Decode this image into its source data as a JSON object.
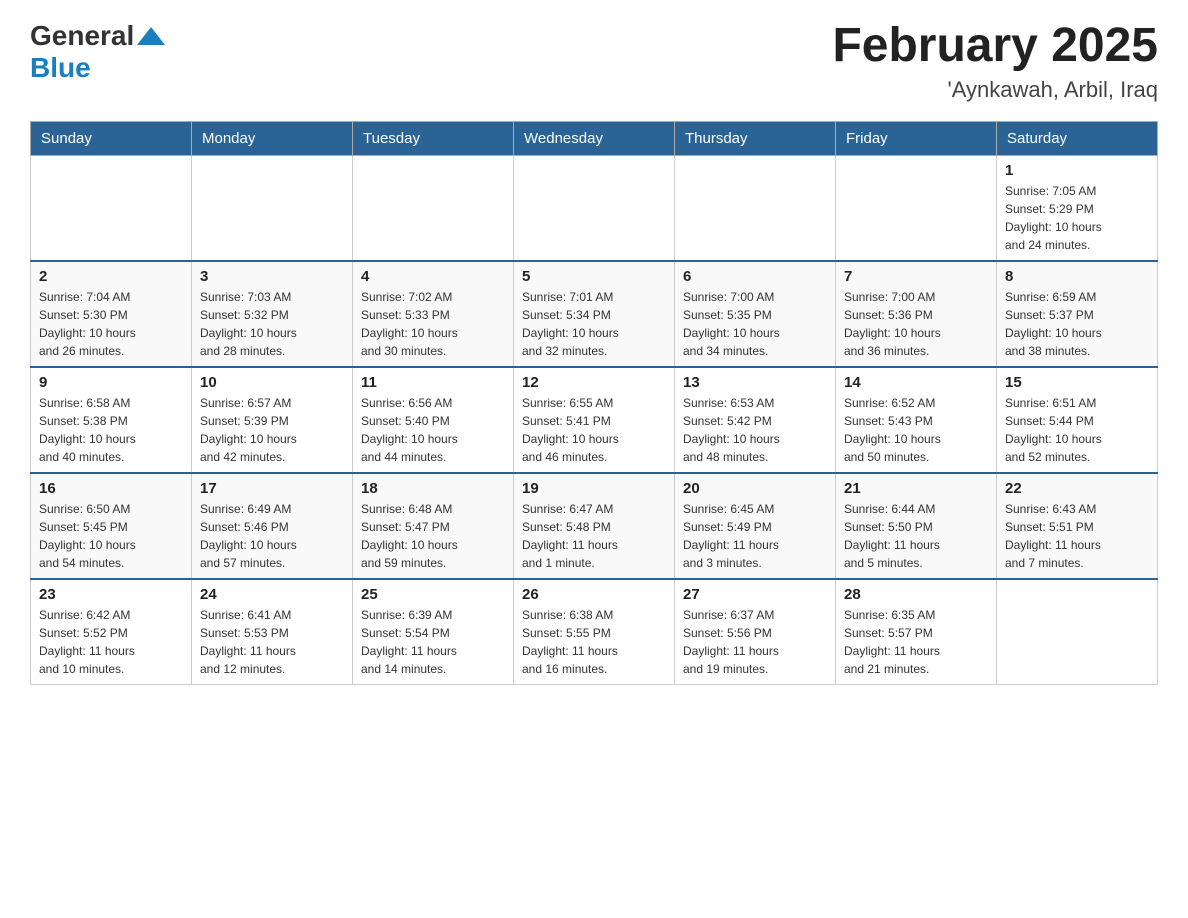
{
  "header": {
    "logo_general": "General",
    "logo_blue": "Blue",
    "title": "February 2025",
    "subtitle": "'Aynkawah, Arbil, Iraq"
  },
  "days_of_week": [
    "Sunday",
    "Monday",
    "Tuesday",
    "Wednesday",
    "Thursday",
    "Friday",
    "Saturday"
  ],
  "weeks": [
    [
      {
        "day": "",
        "info": ""
      },
      {
        "day": "",
        "info": ""
      },
      {
        "day": "",
        "info": ""
      },
      {
        "day": "",
        "info": ""
      },
      {
        "day": "",
        "info": ""
      },
      {
        "day": "",
        "info": ""
      },
      {
        "day": "1",
        "info": "Sunrise: 7:05 AM\nSunset: 5:29 PM\nDaylight: 10 hours\nand 24 minutes."
      }
    ],
    [
      {
        "day": "2",
        "info": "Sunrise: 7:04 AM\nSunset: 5:30 PM\nDaylight: 10 hours\nand 26 minutes."
      },
      {
        "day": "3",
        "info": "Sunrise: 7:03 AM\nSunset: 5:32 PM\nDaylight: 10 hours\nand 28 minutes."
      },
      {
        "day": "4",
        "info": "Sunrise: 7:02 AM\nSunset: 5:33 PM\nDaylight: 10 hours\nand 30 minutes."
      },
      {
        "day": "5",
        "info": "Sunrise: 7:01 AM\nSunset: 5:34 PM\nDaylight: 10 hours\nand 32 minutes."
      },
      {
        "day": "6",
        "info": "Sunrise: 7:00 AM\nSunset: 5:35 PM\nDaylight: 10 hours\nand 34 minutes."
      },
      {
        "day": "7",
        "info": "Sunrise: 7:00 AM\nSunset: 5:36 PM\nDaylight: 10 hours\nand 36 minutes."
      },
      {
        "day": "8",
        "info": "Sunrise: 6:59 AM\nSunset: 5:37 PM\nDaylight: 10 hours\nand 38 minutes."
      }
    ],
    [
      {
        "day": "9",
        "info": "Sunrise: 6:58 AM\nSunset: 5:38 PM\nDaylight: 10 hours\nand 40 minutes."
      },
      {
        "day": "10",
        "info": "Sunrise: 6:57 AM\nSunset: 5:39 PM\nDaylight: 10 hours\nand 42 minutes."
      },
      {
        "day": "11",
        "info": "Sunrise: 6:56 AM\nSunset: 5:40 PM\nDaylight: 10 hours\nand 44 minutes."
      },
      {
        "day": "12",
        "info": "Sunrise: 6:55 AM\nSunset: 5:41 PM\nDaylight: 10 hours\nand 46 minutes."
      },
      {
        "day": "13",
        "info": "Sunrise: 6:53 AM\nSunset: 5:42 PM\nDaylight: 10 hours\nand 48 minutes."
      },
      {
        "day": "14",
        "info": "Sunrise: 6:52 AM\nSunset: 5:43 PM\nDaylight: 10 hours\nand 50 minutes."
      },
      {
        "day": "15",
        "info": "Sunrise: 6:51 AM\nSunset: 5:44 PM\nDaylight: 10 hours\nand 52 minutes."
      }
    ],
    [
      {
        "day": "16",
        "info": "Sunrise: 6:50 AM\nSunset: 5:45 PM\nDaylight: 10 hours\nand 54 minutes."
      },
      {
        "day": "17",
        "info": "Sunrise: 6:49 AM\nSunset: 5:46 PM\nDaylight: 10 hours\nand 57 minutes."
      },
      {
        "day": "18",
        "info": "Sunrise: 6:48 AM\nSunset: 5:47 PM\nDaylight: 10 hours\nand 59 minutes."
      },
      {
        "day": "19",
        "info": "Sunrise: 6:47 AM\nSunset: 5:48 PM\nDaylight: 11 hours\nand 1 minute."
      },
      {
        "day": "20",
        "info": "Sunrise: 6:45 AM\nSunset: 5:49 PM\nDaylight: 11 hours\nand 3 minutes."
      },
      {
        "day": "21",
        "info": "Sunrise: 6:44 AM\nSunset: 5:50 PM\nDaylight: 11 hours\nand 5 minutes."
      },
      {
        "day": "22",
        "info": "Sunrise: 6:43 AM\nSunset: 5:51 PM\nDaylight: 11 hours\nand 7 minutes."
      }
    ],
    [
      {
        "day": "23",
        "info": "Sunrise: 6:42 AM\nSunset: 5:52 PM\nDaylight: 11 hours\nand 10 minutes."
      },
      {
        "day": "24",
        "info": "Sunrise: 6:41 AM\nSunset: 5:53 PM\nDaylight: 11 hours\nand 12 minutes."
      },
      {
        "day": "25",
        "info": "Sunrise: 6:39 AM\nSunset: 5:54 PM\nDaylight: 11 hours\nand 14 minutes."
      },
      {
        "day": "26",
        "info": "Sunrise: 6:38 AM\nSunset: 5:55 PM\nDaylight: 11 hours\nand 16 minutes."
      },
      {
        "day": "27",
        "info": "Sunrise: 6:37 AM\nSunset: 5:56 PM\nDaylight: 11 hours\nand 19 minutes."
      },
      {
        "day": "28",
        "info": "Sunrise: 6:35 AM\nSunset: 5:57 PM\nDaylight: 11 hours\nand 21 minutes."
      },
      {
        "day": "",
        "info": ""
      }
    ]
  ]
}
